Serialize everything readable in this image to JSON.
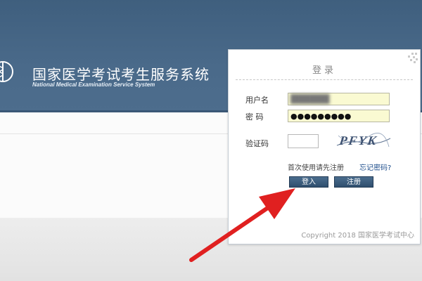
{
  "header": {
    "title": "国家医学考试考生服务系统",
    "subtitle": "National Medical Examination Service System"
  },
  "login": {
    "title": "登录",
    "username_label": "用户名",
    "username_value": "██████",
    "password_label": "密 码",
    "password_value": "●●●●●●●●●",
    "captcha_label": "验证码",
    "captcha_value": "",
    "captcha_image_text": "PFYK",
    "first_time_text": "首次使用请先注册",
    "forgot_link": "忘记密码?",
    "login_button": "登入",
    "register_button": "注册",
    "copyright": "Copyright 2018 国家医学考试中心"
  },
  "colors": {
    "header_bg": "#4a6a8a",
    "input_bg": "#fafad2",
    "button_bg": "#3a5a7a",
    "arrow": "#e02020",
    "link": "#1e4e8c"
  },
  "icons": {
    "logo": "caduceus-logo-icon",
    "arrow": "red-arrow-annotation-icon",
    "corner": "corner-ornament-icon"
  }
}
